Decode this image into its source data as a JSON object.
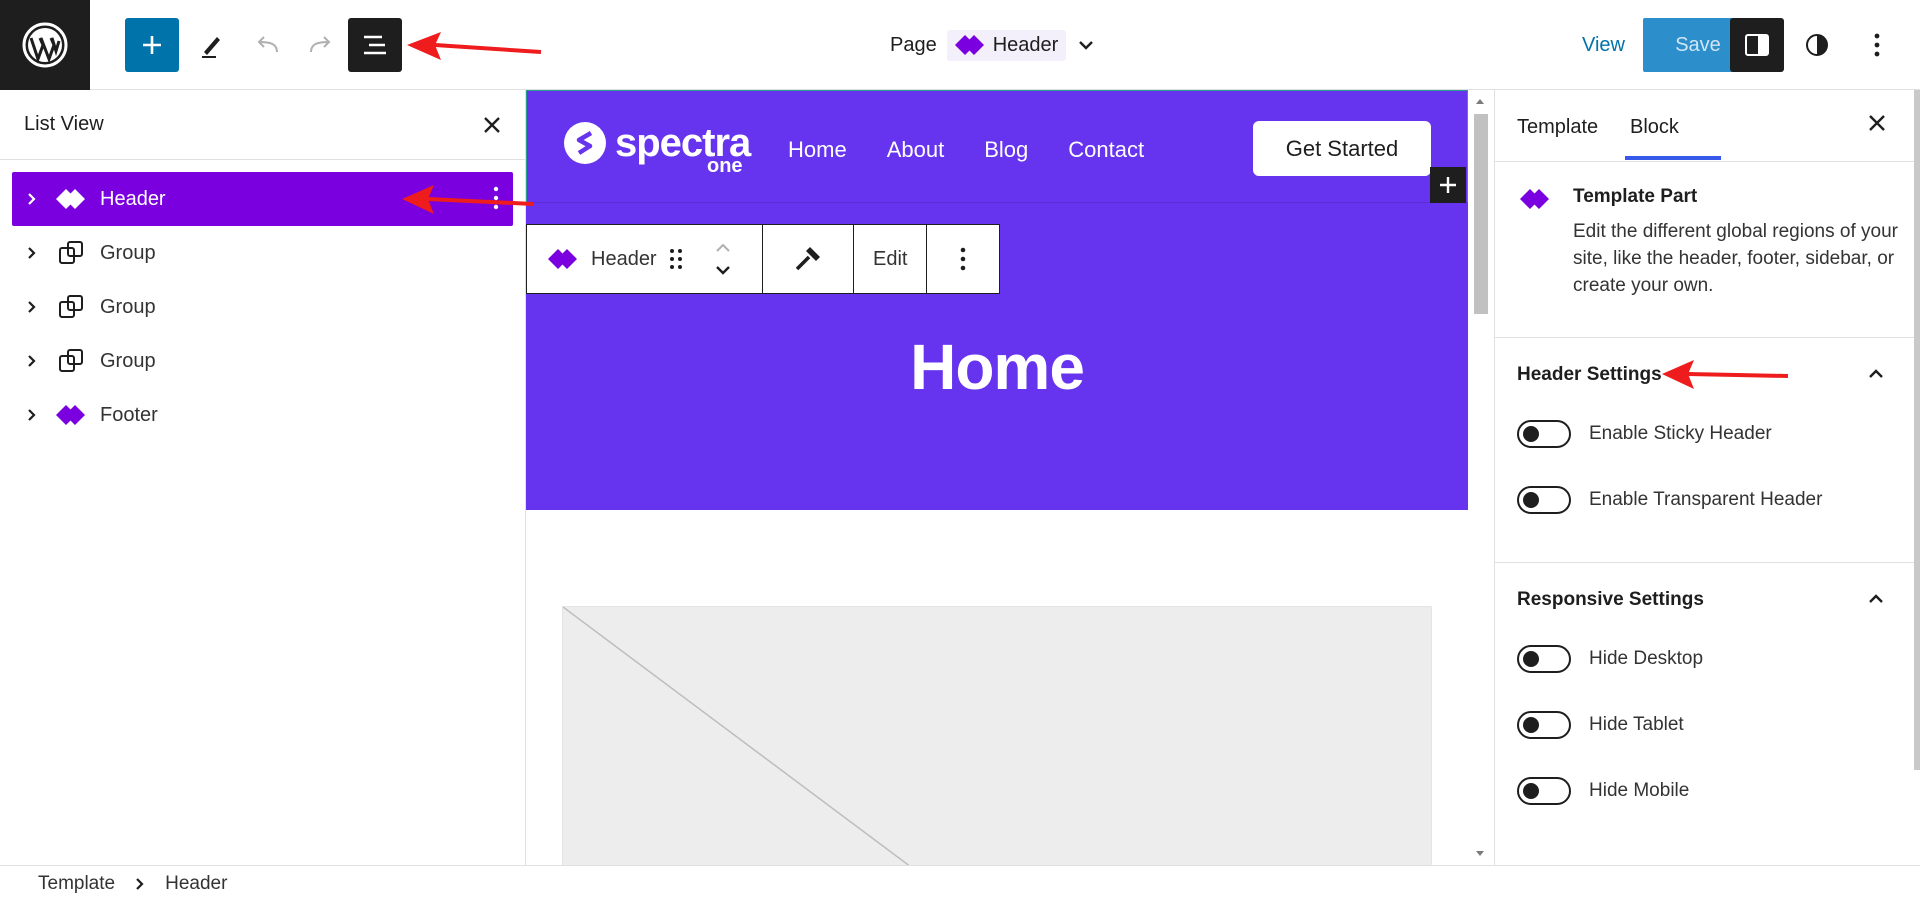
{
  "topbar": {
    "document_type": "Page",
    "document_title": "Header",
    "view_label": "View",
    "save_label": "Save"
  },
  "list_view": {
    "title": "List View",
    "items": [
      {
        "label": "Header",
        "icon": "template-part-icon",
        "selected": true
      },
      {
        "label": "Group",
        "icon": "group-icon",
        "selected": false
      },
      {
        "label": "Group",
        "icon": "group-icon",
        "selected": false
      },
      {
        "label": "Group",
        "icon": "group-icon",
        "selected": false
      },
      {
        "label": "Footer",
        "icon": "template-part-icon",
        "selected": false
      }
    ]
  },
  "canvas": {
    "brand_word": "spectra",
    "brand_sub": "one",
    "menu": [
      "Home",
      "About",
      "Blog",
      "Contact"
    ],
    "cta_label": "Get Started",
    "hero_title": "Home",
    "block_toolbar": {
      "block_label": "Header",
      "edit_label": "Edit"
    }
  },
  "sidebar": {
    "tabs": [
      "Template",
      "Block"
    ],
    "active_tab": "Block",
    "block_name": "Template Part",
    "block_description": "Edit the different global regions of your site, like the header, footer, sidebar, or create your own.",
    "header_settings": {
      "title": "Header Settings",
      "toggles": [
        "Enable Sticky Header",
        "Enable Transparent Header"
      ]
    },
    "responsive_settings": {
      "title": "Responsive Settings",
      "toggles": [
        "Hide Desktop",
        "Hide Tablet",
        "Hide Mobile"
      ]
    }
  },
  "breadcrumb": [
    "Template",
    "Header"
  ],
  "colors": {
    "accent_purple": "#7a00df",
    "header_bg": "#6633ee",
    "wp_blue": "#0073aa",
    "annotation_red": "#ee1c1c"
  }
}
